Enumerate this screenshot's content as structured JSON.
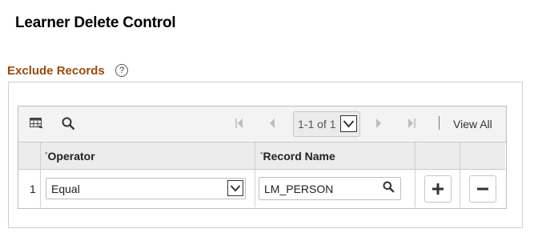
{
  "page": {
    "title": "Learner Delete Control"
  },
  "section": {
    "title": "Exclude Records",
    "help_icon": "help-icon"
  },
  "grid": {
    "toolbar": {
      "personalize_icon": "grid-personalize-icon",
      "search_icon": "search-icon",
      "pager_text": "1-1 of 1",
      "view_all_label": "View All"
    },
    "columns": [
      {
        "label": "Operator",
        "required": true
      },
      {
        "label": "Record Name",
        "required": true
      }
    ],
    "rows": [
      {
        "row_number": "1",
        "operator": "Equal",
        "record_name": "LM_PERSON"
      }
    ]
  }
}
